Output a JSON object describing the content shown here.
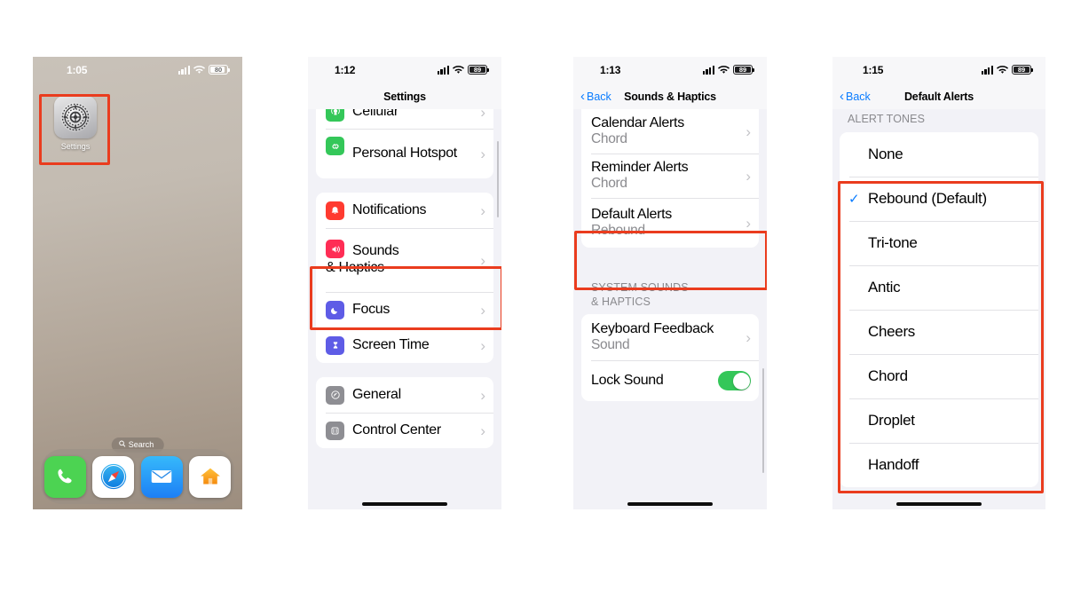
{
  "meta": {
    "accent_red": "#ea3c1e",
    "accent_blue": "#0a7cff",
    "toggle_green": "#34c759",
    "ios_bg": "#f2f2f7"
  },
  "phone1": {
    "name": "home-screen",
    "status": {
      "time": "1:05",
      "battery": "80",
      "cellular": "signal-bars-icon",
      "wifi": "wifi-icon"
    },
    "app": {
      "label": "Settings",
      "icon": "settings-gear-icon"
    },
    "search": {
      "label": "Search",
      "icon": "search-icon"
    },
    "dock": [
      {
        "name": "phone",
        "icon": "phone-icon",
        "label": "Phone"
      },
      {
        "name": "safari",
        "icon": "safari-compass-icon",
        "label": "Safari"
      },
      {
        "name": "mail",
        "icon": "mail-envelope-icon",
        "label": "Mail"
      },
      {
        "name": "home",
        "icon": "home-house-icon",
        "label": "Home"
      }
    ]
  },
  "phone2": {
    "name": "settings-list",
    "status": {
      "time": "1:12",
      "battery": "89"
    },
    "nav": {
      "title": "Settings"
    },
    "group1": [
      {
        "label": "Cellular",
        "icon": "cellular-icon",
        "color": "#34c759",
        "clipped": true
      },
      {
        "label": "Personal Hotspot",
        "icon": "hotspot-icon",
        "color": "#34c759",
        "two_line": true
      }
    ],
    "group2": [
      {
        "label": "Notifications",
        "icon": "notifications-bell-icon",
        "color": "#ff3b30"
      },
      {
        "label": "Sounds & Haptics",
        "icon": "sounds-speaker-icon",
        "color": "#ff2d55",
        "two_line": true,
        "highlighted": true
      },
      {
        "label": "Focus",
        "icon": "focus-moon-icon",
        "color": "#5856d6"
      },
      {
        "label": "Screen Time",
        "icon": "screen-time-hourglass-icon",
        "color": "#5856d6"
      }
    ],
    "group3": [
      {
        "label": "General",
        "icon": "general-gear-icon",
        "color": "#8e8e93"
      },
      {
        "label": "Control Center",
        "icon": "control-center-icon",
        "color": "#8e8e93",
        "clipped": true
      }
    ]
  },
  "phone3": {
    "name": "sounds-and-haptics",
    "status": {
      "time": "1:13",
      "battery": "89"
    },
    "nav": {
      "back": "Back",
      "title": "Sounds & Haptics"
    },
    "group1": [
      {
        "label": "Calendar Alerts",
        "value": "Chord"
      },
      {
        "label": "Reminder Alerts",
        "value": "Chord"
      },
      {
        "label": "Default Alerts",
        "value": "Rebound",
        "highlighted": true
      }
    ],
    "section_header": "SYSTEM SOUNDS & HAPTICS",
    "group2": [
      {
        "label": "Keyboard Feedback",
        "value": "Sound",
        "type": "disclosure"
      },
      {
        "label": "Lock Sound",
        "type": "toggle",
        "on": true
      }
    ]
  },
  "phone4": {
    "name": "default-alerts",
    "status": {
      "time": "1:15",
      "battery": "89"
    },
    "nav": {
      "back": "Back",
      "title": "Default Alerts"
    },
    "section_header": "ALERT TONES",
    "tones": [
      {
        "label": "None",
        "selected": false
      },
      {
        "label": "Rebound (Default)",
        "selected": true
      },
      {
        "label": "Tri-tone",
        "selected": false
      },
      {
        "label": "Antic",
        "selected": false
      },
      {
        "label": "Cheers",
        "selected": false
      },
      {
        "label": "Chord",
        "selected": false
      },
      {
        "label": "Droplet",
        "selected": false
      },
      {
        "label": "Handoff",
        "selected": false
      }
    ]
  }
}
